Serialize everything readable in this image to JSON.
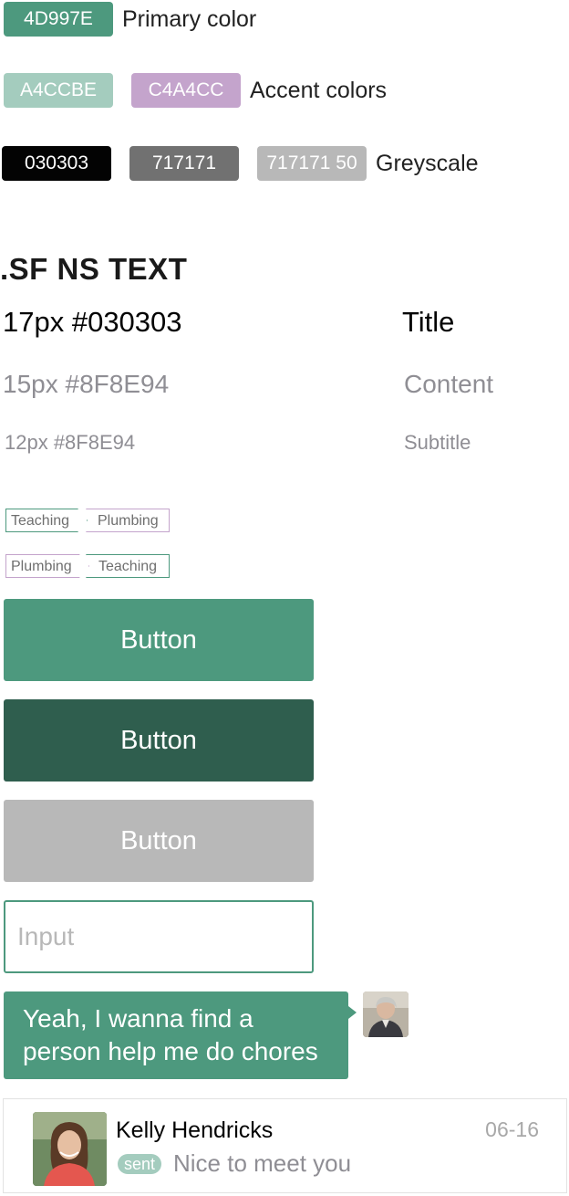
{
  "colors": {
    "primary": {
      "hex": "#4D997E",
      "label": "4D997E",
      "caption": "Primary color"
    },
    "accents": [
      {
        "hex": "#A4CCBE",
        "label": "A4CCBE"
      },
      {
        "hex": "#C4A4CC",
        "label": "C4A4CC"
      }
    ],
    "accent_caption": "Accent colors",
    "greys": [
      {
        "hex": "#030303",
        "label": "030303"
      },
      {
        "hex": "#717171",
        "label": "717171"
      },
      {
        "hex": "#B8B8B8",
        "label": "717171 50"
      }
    ],
    "grey_caption": "Greyscale"
  },
  "typography": {
    "font_heading": ".SF NS TEXT",
    "rows": [
      {
        "spec": "17px #030303",
        "sample": "Title"
      },
      {
        "spec": "15px #8F8E94",
        "sample": "Content"
      },
      {
        "spec": "12px #8F8E94",
        "sample": "Subtitle"
      }
    ]
  },
  "tags": {
    "row1": [
      "Teaching",
      "Plumbing"
    ],
    "row2": [
      "Plumbing",
      "Teaching"
    ]
  },
  "buttons": {
    "primary_label": "Button",
    "dark_label": "Button",
    "disabled_label": "Button"
  },
  "input": {
    "placeholder": "Input"
  },
  "chat": {
    "message_line1": "Yeah, I wanna find a",
    "message_line2": "person help me do chores"
  },
  "contact": {
    "name": "Kelly Hendricks",
    "date": "06-16",
    "status": "sent",
    "message": "Nice to meet you"
  }
}
